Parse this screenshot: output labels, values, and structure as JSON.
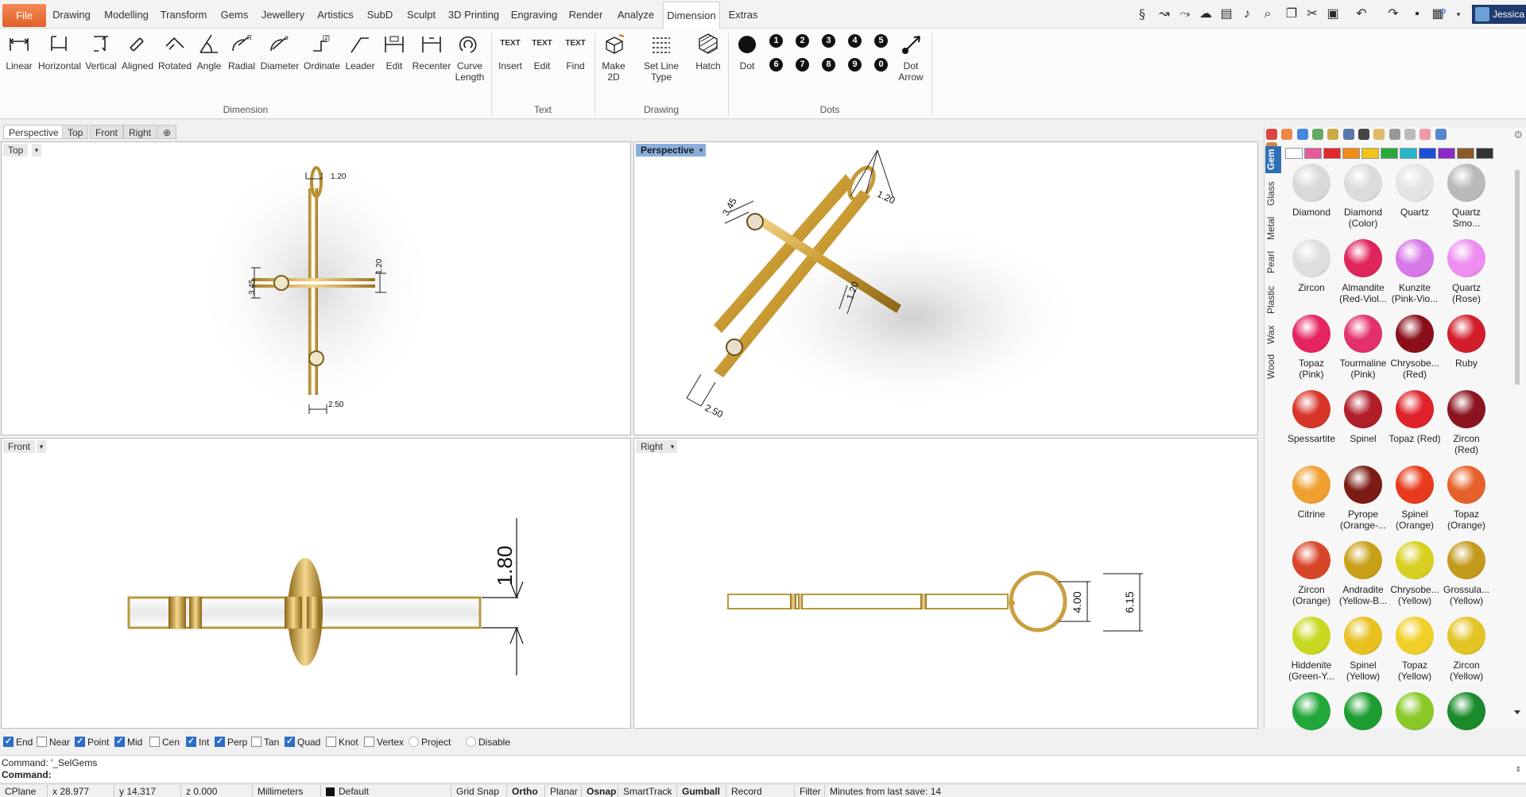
{
  "menu": {
    "tabs": [
      "File",
      "Drawing",
      "Modelling",
      "Transform",
      "Gems",
      "Jewellery",
      "Artistics",
      "SubD",
      "Sculpt",
      "3D Printing",
      "Engraving",
      "Render",
      "Analyze",
      "Dimension",
      "Extras"
    ],
    "active": "Dimension",
    "user": "Jessica"
  },
  "ribbon": {
    "dimension": [
      "Linear",
      "Horizontal",
      "Vertical",
      "Aligned",
      "Rotated",
      "Angle",
      "Radial",
      "Diameter",
      "Ordinate",
      "Leader",
      "Edit",
      "Recenter",
      "Curve Length"
    ],
    "text": [
      "Insert",
      "Edit",
      "Find"
    ],
    "drawing": [
      "Make 2D",
      "Set Line Type",
      "Hatch"
    ],
    "dots": {
      "dot": "Dot",
      "dot_arrow": "Dot Arrow",
      "numbers": [
        "1",
        "2",
        "3",
        "4",
        "5",
        "6",
        "7",
        "8",
        "9",
        "0"
      ]
    },
    "groups": {
      "dimension": "Dimension",
      "text": "Text",
      "drawing": "Drawing",
      "dots": "Dots"
    },
    "text_icon_label": "TEXT"
  },
  "viewport_tabs": [
    "Perspective",
    "Top",
    "Front",
    "Right"
  ],
  "viewports": {
    "top": {
      "label": "Top",
      "dims": [
        "1.20",
        "1.20",
        "3.45",
        "2.50"
      ]
    },
    "perspective": {
      "label": "Perspective",
      "dims": [
        "1.20",
        "3.45",
        "1.20",
        "2.50"
      ]
    },
    "front": {
      "label": "Front",
      "dims": [
        "1.80"
      ]
    },
    "right": {
      "label": "Right",
      "dims": [
        "4.00",
        "6.15"
      ]
    }
  },
  "panel": {
    "material_tabs": [
      "Gem",
      "Glass",
      "Metal",
      "Pearl",
      "Plastic",
      "Wax",
      "Wood"
    ],
    "active_tab": "Gem",
    "swatch_colors": [
      "#ffffff",
      "#e65a9c",
      "#e02a2a",
      "#f08a14",
      "#f2c21a",
      "#2aa83a",
      "#25b7c9",
      "#1a4fd6",
      "#8a2ac9",
      "#8a5a2a",
      "#333333"
    ],
    "gems": [
      {
        "name": "Diamond",
        "color": "#d9d9d9"
      },
      {
        "name": "Diamond (Color)",
        "color": "#dcdcdc"
      },
      {
        "name": "Quartz",
        "color": "#e4e4e4"
      },
      {
        "name": "Quartz Smo...",
        "color": "#b9b9b9"
      },
      {
        "name": "Zircon",
        "color": "#dedede"
      },
      {
        "name": "Almandite (Red-Viol...",
        "color": "#e0245c"
      },
      {
        "name": "Kunzite (Pink-Vio...",
        "color": "#d678e8"
      },
      {
        "name": "Quartz (Rose)",
        "color": "#ee8ef0"
      },
      {
        "name": "Topaz (Pink)",
        "color": "#e6245f"
      },
      {
        "name": "Tourmaline (Pink)",
        "color": "#e2306a"
      },
      {
        "name": "Chrysobe... (Red)",
        "color": "#8a0f1a"
      },
      {
        "name": "Ruby",
        "color": "#d21e2a"
      },
      {
        "name": "Spessartite",
        "color": "#d8352a"
      },
      {
        "name": "Spinel",
        "color": "#b01e2a"
      },
      {
        "name": "Topaz (Red)",
        "color": "#e0222a"
      },
      {
        "name": "Zircon (Red)",
        "color": "#8c1420"
      },
      {
        "name": "Citrine",
        "color": "#f0a030"
      },
      {
        "name": "Pyrope (Orange-...",
        "color": "#7a1c14"
      },
      {
        "name": "Spinel (Orange)",
        "color": "#e83a1c"
      },
      {
        "name": "Topaz (Orange)",
        "color": "#e4622a"
      },
      {
        "name": "Zircon (Orange)",
        "color": "#d8462a"
      },
      {
        "name": "Andradite (Yellow-B...",
        "color": "#c8a018"
      },
      {
        "name": "Chrysobe... (Yellow)",
        "color": "#d8d020"
      },
      {
        "name": "Grossula... (Yellow)",
        "color": "#c49a1c"
      },
      {
        "name": "Hiddenite (Green-Y...",
        "color": "#c8d820"
      },
      {
        "name": "Spinel (Yellow)",
        "color": "#e8c020"
      },
      {
        "name": "Topaz (Yellow)",
        "color": "#f0d028"
      },
      {
        "name": "Zircon (Yellow)",
        "color": "#e2c424"
      },
      {
        "name": "",
        "color": "#22a83a"
      },
      {
        "name": "",
        "color": "#1e9e32"
      },
      {
        "name": "",
        "color": "#8ac828"
      },
      {
        "name": "",
        "color": "#1a8a2a"
      }
    ]
  },
  "osnap": [
    {
      "label": "End",
      "on": true
    },
    {
      "label": "Near",
      "on": false
    },
    {
      "label": "Point",
      "on": true
    },
    {
      "label": "Mid",
      "on": true
    },
    {
      "label": "Cen",
      "on": false
    },
    {
      "label": "Int",
      "on": true
    },
    {
      "label": "Perp",
      "on": true
    },
    {
      "label": "Tan",
      "on": false
    },
    {
      "label": "Quad",
      "on": true
    },
    {
      "label": "Knot",
      "on": false
    },
    {
      "label": "Vertex",
      "on": false
    },
    {
      "label": "Project",
      "on": false,
      "radio": true
    },
    {
      "label": "Disable",
      "on": false,
      "radio": true
    }
  ],
  "command": {
    "history": "Command: '_SelGems",
    "prompt": "Command:"
  },
  "status": {
    "cplane": "CPlane",
    "x": "x 28.977",
    "y": "y 14.317",
    "z": "z 0.000",
    "units": "Millimeters",
    "layer": "Default",
    "grid_snap": "Grid Snap",
    "ortho": "Ortho",
    "planar": "Planar",
    "osnap": "Osnap",
    "smarttrack": "SmartTrack",
    "gumball": "Gumball",
    "record_history": "Record History",
    "filter": "Filter",
    "save_info": "Minutes from last save: 14"
  }
}
